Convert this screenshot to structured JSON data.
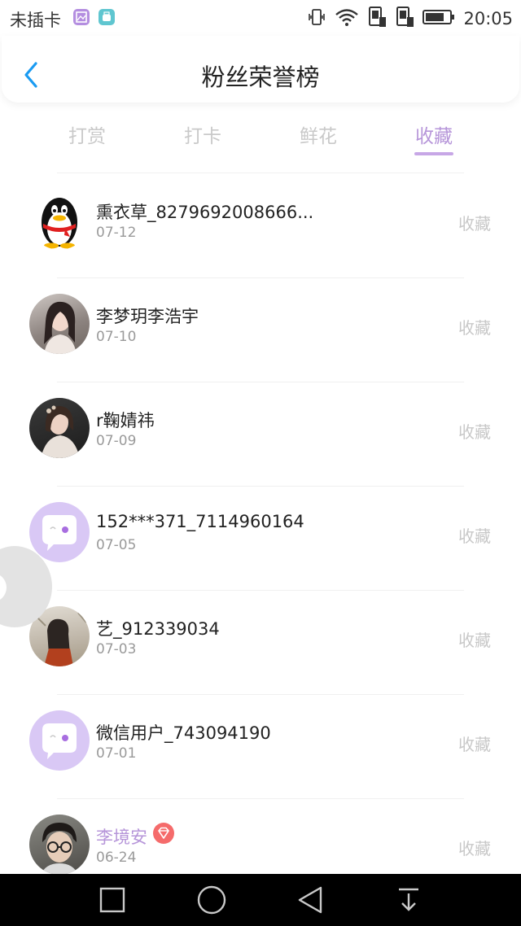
{
  "status_bar": {
    "carrier": "未插卡",
    "time": "20:05",
    "icons": [
      "gallery-app-icon",
      "huawei-app-icon",
      "vibrate-icon",
      "wifi-icon",
      "sim1-icon",
      "sim2-icon",
      "battery-icon"
    ]
  },
  "header": {
    "title": "粉丝荣誉榜",
    "back_icon": "chevron-left-icon"
  },
  "tabs": [
    {
      "label": "打赏",
      "active": false
    },
    {
      "label": "打卡",
      "active": false
    },
    {
      "label": "鲜花",
      "active": false
    },
    {
      "label": "收藏",
      "active": true
    }
  ],
  "accent_color": "#b695d9",
  "fans": [
    {
      "name": "熏衣草_8279692008666...",
      "date": "07-12",
      "action": "收藏",
      "avatar": "qq-penguin-avatar"
    },
    {
      "name": "李梦玥李浩宇",
      "date": "07-10",
      "action": "收藏",
      "avatar": "photo-avatar"
    },
    {
      "name": "r鞠婧祎",
      "date": "07-09",
      "action": "收藏",
      "avatar": "photo-avatar"
    },
    {
      "name": "152***371_7114960164",
      "date": "07-05",
      "action": "收藏",
      "avatar": "default-chat-avatar"
    },
    {
      "name": "艺_912339034",
      "date": "07-03",
      "action": "收藏",
      "avatar": "photo-avatar"
    },
    {
      "name": "微信用户_743094190",
      "date": "07-01",
      "action": "收藏",
      "avatar": "default-chat-avatar"
    },
    {
      "name": "李境安",
      "date": "06-24",
      "action": "收藏",
      "avatar": "photo-avatar",
      "vip": true
    }
  ],
  "nav_bar": [
    "recent-apps-icon",
    "home-icon",
    "back-icon",
    "notification-pull-icon"
  ]
}
